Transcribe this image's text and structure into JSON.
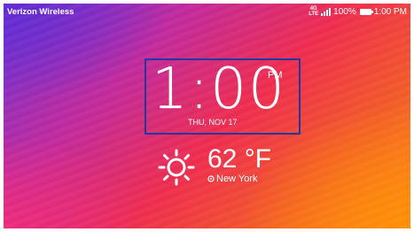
{
  "status_bar": {
    "carrier": "Verizon Wireless",
    "network": "4G",
    "network_sub": "LTE",
    "battery": "100%",
    "time": "1:00 PM"
  },
  "clock": {
    "time": "1:00",
    "ampm": "PM",
    "date": "THU, NOV 17"
  },
  "weather": {
    "temperature": "62 °F",
    "location": "New York",
    "icon": "sun-icon",
    "location_icon": "location-pin-icon"
  },
  "colors": {
    "highlight_border": "#1d3aa3",
    "text": "#ffffff"
  }
}
